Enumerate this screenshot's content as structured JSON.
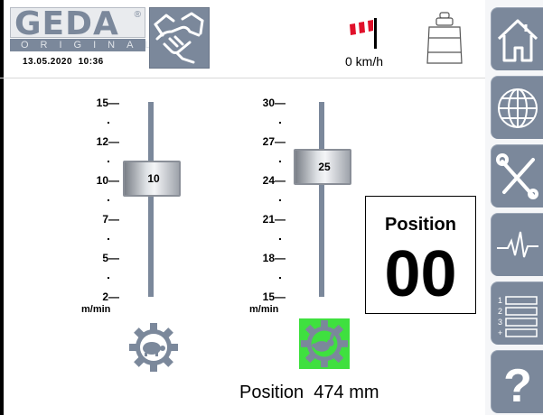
{
  "header": {
    "brand": "GEDA",
    "brand_mark": "®",
    "brand_sub": "ORIGINAL",
    "date": "13.05.2020",
    "time": "10:36",
    "wind_speed": "0 km/h"
  },
  "sidebar": {
    "buttons": [
      "home-icon",
      "globe-icon",
      "tools-icon",
      "pulse-icon",
      "list-icon",
      "help-icon"
    ],
    "list_numbers": [
      "1",
      "2",
      "3",
      "+"
    ],
    "help_label": "?"
  },
  "slider_left": {
    "labels": [
      "15—",
      "12—",
      "10—",
      "7—",
      "5—",
      "2—"
    ],
    "unit": "m/min",
    "value": "10",
    "min": 2,
    "max": 15,
    "mode_icon": "turtle-gear-icon",
    "active": false
  },
  "slider_right": {
    "labels": [
      "30—",
      "27—",
      "24—",
      "21—",
      "18—",
      "15—"
    ],
    "unit": "m/min",
    "value": "25",
    "min": 15,
    "max": 30,
    "mode_icon": "rabbit-gear-icon",
    "active": true
  },
  "position_panel": {
    "title": "Position",
    "value": "00"
  },
  "position_readout": {
    "label": "Position",
    "value": "474",
    "unit": "mm"
  },
  "colors": {
    "accent": "#7b889b",
    "active_green": "#3fe03f",
    "wind_red": "#e0102a"
  }
}
